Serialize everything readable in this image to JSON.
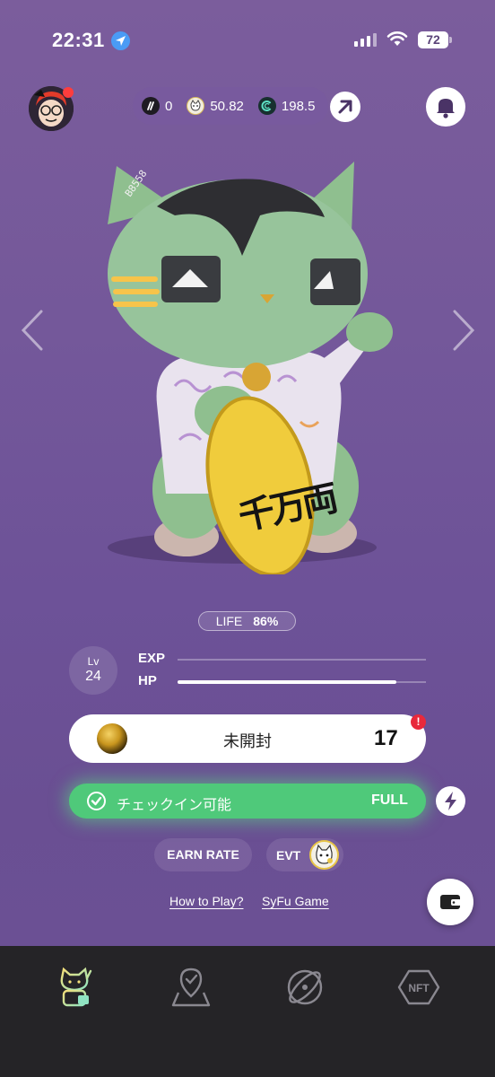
{
  "status_bar": {
    "time": "22:31",
    "battery": "72"
  },
  "header": {
    "balances": [
      {
        "icon": "stripe-token-icon",
        "value": "0"
      },
      {
        "icon": "cat-token-icon",
        "value": "50.82"
      },
      {
        "icon": "c-token-icon",
        "value": "198.5"
      }
    ]
  },
  "hero": {
    "plaque_text": "千万両",
    "badge_text": "B8558"
  },
  "stats": {
    "life_label": "LIFE",
    "life_pct": "86%",
    "life_value": 0.86,
    "level_label": "Lv",
    "level_value": "24",
    "exp_label": "EXP",
    "hp_label": "HP",
    "exp_value": 0.0,
    "hp_value": 0.88
  },
  "box": {
    "label": "未開封",
    "count": "17",
    "alert": "!"
  },
  "checkin": {
    "label": "チェックイン可能",
    "status": "FULL"
  },
  "actions": {
    "earn_rate": "EARN RATE",
    "evt": "EVT"
  },
  "links": {
    "how_to_play": "How to Play?",
    "game": "SyFu Game"
  },
  "tabbar": {
    "tabs": [
      {
        "icon": "lucky-cat-icon",
        "active": true
      },
      {
        "icon": "map-pin-icon",
        "active": false
      },
      {
        "icon": "orbit-icon",
        "active": false
      },
      {
        "icon": "nft-hexagon-icon",
        "label": "NFT",
        "active": false
      }
    ]
  },
  "colors": {
    "background": "#74589a",
    "accent_green": "#4fc97a",
    "alert_red": "#e8293b",
    "tabbar": "#252427"
  }
}
